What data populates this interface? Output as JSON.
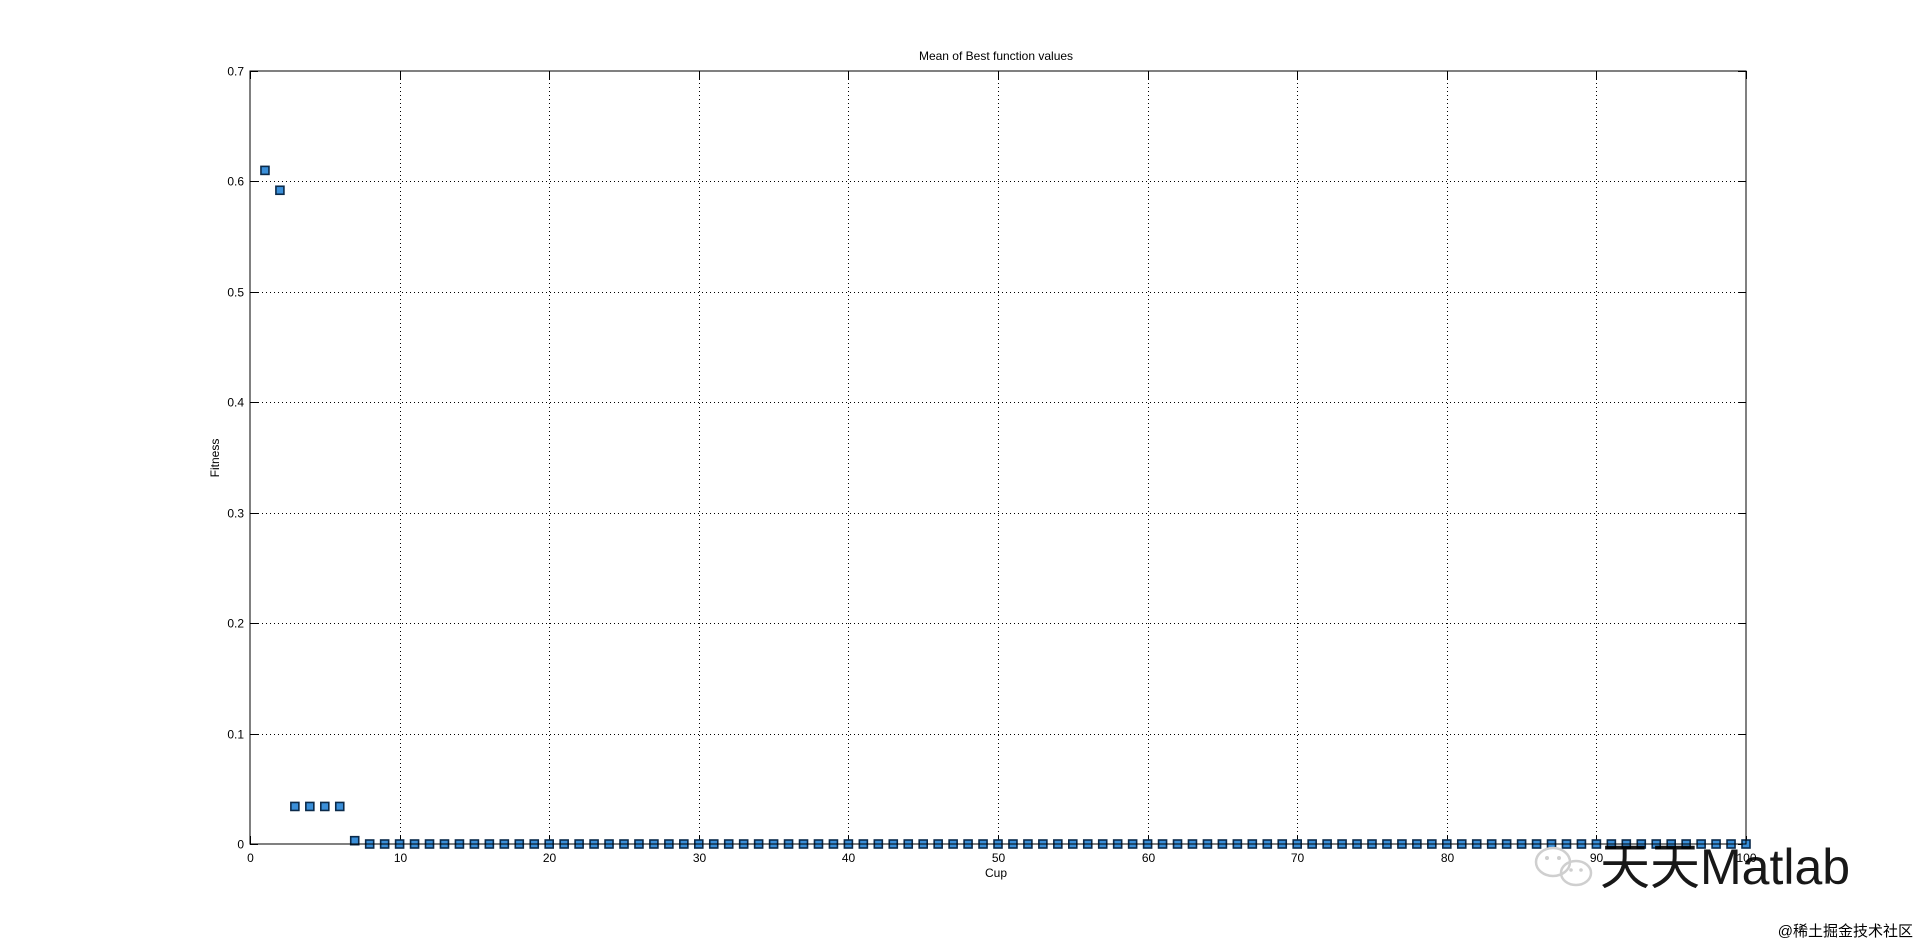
{
  "chart_data": {
    "type": "scatter",
    "title": "Mean of Best function values",
    "xlabel": "Cup",
    "ylabel": "Fitness",
    "xlim": [
      0,
      100
    ],
    "ylim": [
      0,
      0.7
    ],
    "xticks": [
      0,
      10,
      20,
      30,
      40,
      50,
      60,
      70,
      80,
      90,
      100
    ],
    "xtick_labels": [
      "0",
      "10",
      "20",
      "30",
      "40",
      "50",
      "60",
      "70",
      "80",
      "90",
      "100"
    ],
    "yticks": [
      0,
      0.1,
      0.2,
      0.3,
      0.4,
      0.5,
      0.6,
      0.7
    ],
    "ytick_labels": [
      "0",
      "0.1",
      "0.2",
      "0.3",
      "0.4",
      "0.5",
      "0.6",
      "0.7"
    ],
    "grid": true,
    "marker": "square",
    "marker_face_color": "#3a8fd9",
    "marker_edge_color": "#0b2a4a",
    "x": [
      1,
      2,
      3,
      4,
      5,
      6,
      7,
      8,
      9,
      10,
      11,
      12,
      13,
      14,
      15,
      16,
      17,
      18,
      19,
      20,
      21,
      22,
      23,
      24,
      25,
      26,
      27,
      28,
      29,
      30,
      31,
      32,
      33,
      34,
      35,
      36,
      37,
      38,
      39,
      40,
      41,
      42,
      43,
      44,
      45,
      46,
      47,
      48,
      49,
      50,
      51,
      52,
      53,
      54,
      55,
      56,
      57,
      58,
      59,
      60,
      61,
      62,
      63,
      64,
      65,
      66,
      67,
      68,
      69,
      70,
      71,
      72,
      73,
      74,
      75,
      76,
      77,
      78,
      79,
      80,
      81,
      82,
      83,
      84,
      85,
      86,
      87,
      88,
      89,
      90,
      91,
      92,
      93,
      94,
      95,
      96,
      97,
      98,
      99,
      100
    ],
    "y": [
      0.61,
      0.592,
      0.034,
      0.034,
      0.034,
      0.034,
      0.003,
      0,
      0,
      0,
      0,
      0,
      0,
      0,
      0,
      0,
      0,
      0,
      0,
      0,
      0,
      0,
      0,
      0,
      0,
      0,
      0,
      0,
      0,
      0,
      0,
      0,
      0,
      0,
      0,
      0,
      0,
      0,
      0,
      0,
      0,
      0,
      0,
      0,
      0,
      0,
      0,
      0,
      0,
      0,
      0,
      0,
      0,
      0,
      0,
      0,
      0,
      0,
      0,
      0,
      0,
      0,
      0,
      0,
      0,
      0,
      0,
      0,
      0,
      0,
      0,
      0,
      0,
      0,
      0,
      0,
      0,
      0,
      0,
      0,
      0,
      0,
      0,
      0,
      0,
      0,
      0,
      0,
      0,
      0,
      0,
      0,
      0,
      0,
      0,
      0,
      0,
      0,
      0,
      0
    ]
  },
  "watermark": {
    "main": "天天Matlab",
    "footer": "@稀土掘金技术社区",
    "icon": "wechat-icon",
    "color": "#d0d0d0"
  }
}
